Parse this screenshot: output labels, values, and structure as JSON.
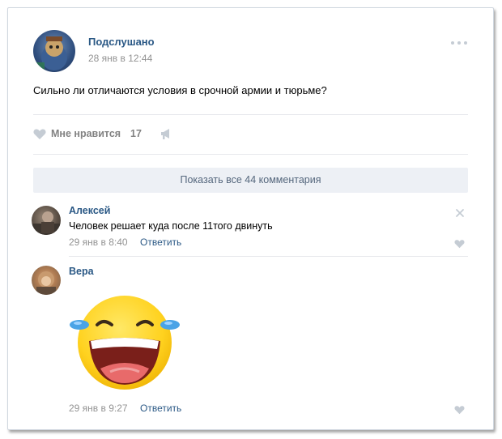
{
  "post": {
    "author": "Подслушано",
    "date": "28 янв в 12:44",
    "text": "Сильно ли отличаются условия в срочной армии и тюрьме?",
    "like_label": "Мне нравится",
    "like_count": "17"
  },
  "comments_toggle": {
    "label": "Показать все 44 комментария"
  },
  "comments": [
    {
      "author": "Алексей",
      "text": "Человек решает куда после 11того двинуть",
      "date": "29 янв в 8:40",
      "reply": "Ответить"
    },
    {
      "author": "Вера",
      "sticker": "laughing-tears-emoji",
      "date": "29 янв в 9:27",
      "reply": "Ответить"
    }
  ],
  "icons": {
    "more": "more-dots-icon",
    "like": "heart-icon",
    "share": "megaphone-icon",
    "close": "close-icon"
  },
  "colors": {
    "link": "#2a5885",
    "meta": "#939393",
    "button_bg": "#edf0f5",
    "emoji_yellow": "#ffd93b",
    "tears": "#4aa3e6"
  }
}
